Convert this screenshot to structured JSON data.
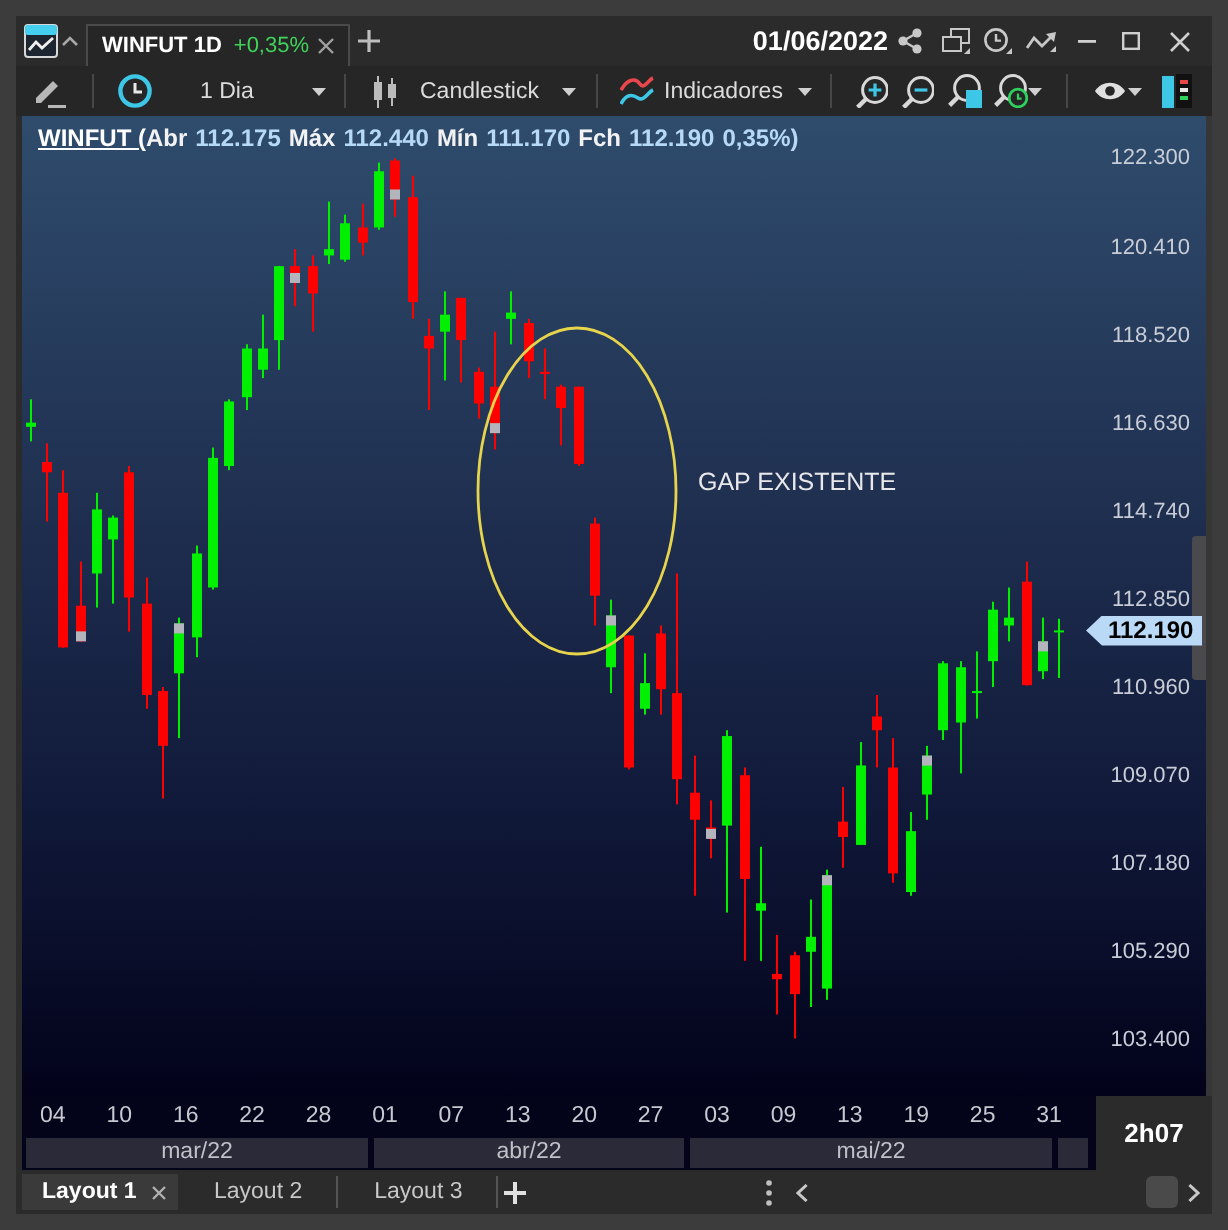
{
  "title_bar": {
    "tabs": [
      {
        "label": "WINFUT 1D",
        "change": "+0,35%",
        "selected": true
      }
    ],
    "date": "01/06/2022"
  },
  "toolbar": {
    "period": "1 Dia",
    "chart_type": "Candlestick",
    "indicators": "Indicadores"
  },
  "chart": {
    "legend": {
      "symbol": "WINFUT (",
      "fields": [
        {
          "label": "Abr",
          "value": "112.175"
        },
        {
          "label": "Máx",
          "value": "112.440"
        },
        {
          "label": "Mín",
          "value": "111.170"
        },
        {
          "label": "Fch",
          "value": "112.190"
        }
      ],
      "change": "0,35%)"
    },
    "annotation": "GAP EXISTENTE",
    "last_price": "112.190",
    "months": [
      "mar/22",
      "abr/22",
      "mai/22"
    ],
    "chart_data": {
      "type": "candlestick",
      "categories": [
        null,
        "04",
        null,
        null,
        null,
        "10",
        null,
        null,
        null,
        "16",
        null,
        null,
        null,
        "22",
        null,
        null,
        null,
        "28",
        null,
        null,
        null,
        "01",
        null,
        null,
        null,
        "07",
        null,
        null,
        null,
        "13",
        null,
        null,
        null,
        "20",
        null,
        null,
        null,
        "27",
        null,
        null,
        null,
        "03",
        null,
        null,
        null,
        "09",
        null,
        null,
        null,
        "13",
        null,
        null,
        null,
        "19",
        null,
        null,
        null,
        "25",
        null,
        null,
        null,
        "31",
        null
      ],
      "ohlc": [
        [
          116555,
          117145,
          116245,
          116645
        ],
        [
          115800,
          116200,
          114525,
          115580
        ],
        [
          115140,
          115625,
          111820,
          111825
        ],
        [
          112720,
          113665,
          111950,
          111955
        ],
        [
          113410,
          115140,
          112680,
          114785
        ],
        [
          114140,
          114655,
          112765,
          114610
        ],
        [
          115580,
          115715,
          112165,
          112895
        ],
        [
          112765,
          113325,
          110510,
          110805
        ],
        [
          110890,
          110975,
          108585,
          109715
        ],
        [
          111270,
          112465,
          109880,
          112340
        ],
        [
          112040,
          114010,
          111615,
          113840
        ],
        [
          113110,
          116110,
          113065,
          115890
        ],
        [
          115715,
          117145,
          115625,
          117100
        ],
        [
          117190,
          118325,
          116915,
          118235
        ],
        [
          117780,
          118960,
          117600,
          118235
        ],
        [
          118415,
          120005,
          117780,
          120000
        ],
        [
          120000,
          120365,
          119140,
          119640
        ],
        [
          120000,
          120230,
          118595,
          119415
        ],
        [
          120230,
          121385,
          120045,
          120365
        ],
        [
          120140,
          121105,
          120095,
          120920
        ],
        [
          120830,
          121340,
          120230,
          120505
        ],
        [
          120830,
          122220,
          120780,
          122035
        ],
        [
          122265,
          122315,
          121060,
          121430
        ],
        [
          121480,
          121940,
          118870,
          119230
        ],
        [
          118505,
          118870,
          116915,
          118235
        ],
        [
          118595,
          119460,
          117550,
          118960
        ],
        [
          119320,
          119325,
          117505,
          118415
        ],
        [
          117735,
          117825,
          116735,
          117055
        ],
        [
          117415,
          118595,
          116070,
          116420
        ],
        [
          118870,
          119460,
          118325,
          119005
        ],
        [
          118780,
          118870,
          117600,
          117960
        ],
        [
          117735,
          118235,
          117145,
          117690
        ],
        [
          117415,
          117460,
          116155,
          116960
        ],
        [
          117415,
          117420,
          115715,
          115760
        ],
        [
          114480,
          114610,
          112295,
          112935
        ],
        [
          111400,
          112850,
          110845,
          112510
        ],
        [
          112080,
          112085,
          109210,
          109250
        ],
        [
          110510,
          111700,
          110385,
          111060
        ],
        [
          112125,
          112295,
          110385,
          110930
        ],
        [
          110845,
          113410,
          108460,
          109000
        ],
        [
          108710,
          109505,
          106500,
          108130
        ],
        [
          107965,
          108545,
          107305,
          107720
        ],
        [
          108005,
          110050,
          106140,
          109925
        ],
        [
          109085,
          109250,
          105105,
          106860
        ],
        [
          106180,
          107550,
          105105,
          106340
        ],
        [
          104825,
          105660,
          103955,
          104710
        ],
        [
          105225,
          105300,
          103440,
          104390
        ],
        [
          105300,
          106420,
          104115,
          105620
        ],
        [
          104510,
          107060,
          104270,
          106940
        ],
        [
          108090,
          108835,
          107100,
          107760
        ],
        [
          107590,
          109795,
          107590,
          109295
        ],
        [
          110345,
          110805,
          109250,
          110050
        ],
        [
          109250,
          109880,
          106780,
          106980
        ],
        [
          106580,
          108295,
          106500,
          107885
        ],
        [
          108670,
          109715,
          108130,
          109505
        ],
        [
          110050,
          111530,
          109840,
          111485
        ],
        [
          110215,
          111530,
          109125,
          111400
        ],
        [
          110845,
          111740,
          110300,
          110890
        ],
        [
          111530,
          112805,
          110975,
          112635
        ],
        [
          112295,
          113110,
          111955,
          112465
        ],
        [
          113235,
          113665,
          111010,
          111015
        ],
        [
          111315,
          112465,
          111145,
          111955
        ],
        [
          112175,
          112440,
          111170,
          112190
        ]
      ],
      "ylim": [
        100620,
        123220
      ],
      "yticks": [
        {
          "value": 122300,
          "label": "122.300"
        },
        {
          "value": 120410,
          "label": "120.410"
        },
        {
          "value": 118520,
          "label": "118.520"
        },
        {
          "value": 116630,
          "label": "116.630"
        },
        {
          "value": 114740,
          "label": "114.740"
        },
        {
          "value": 112850,
          "label": "112.850"
        },
        {
          "value": 110960,
          "label": "110.960"
        },
        {
          "value": 109070,
          "label": "109.070"
        },
        {
          "value": 107180,
          "label": "107.180"
        },
        {
          "value": 105290,
          "label": "105.290"
        },
        {
          "value": 103400,
          "label": "103.400"
        }
      ]
    }
  },
  "countdown": "2h07",
  "layouts": [
    {
      "label": "Layout 1",
      "selected": true
    },
    {
      "label": "Layout 2",
      "selected": false
    },
    {
      "label": "Layout 3",
      "selected": false
    }
  ]
}
